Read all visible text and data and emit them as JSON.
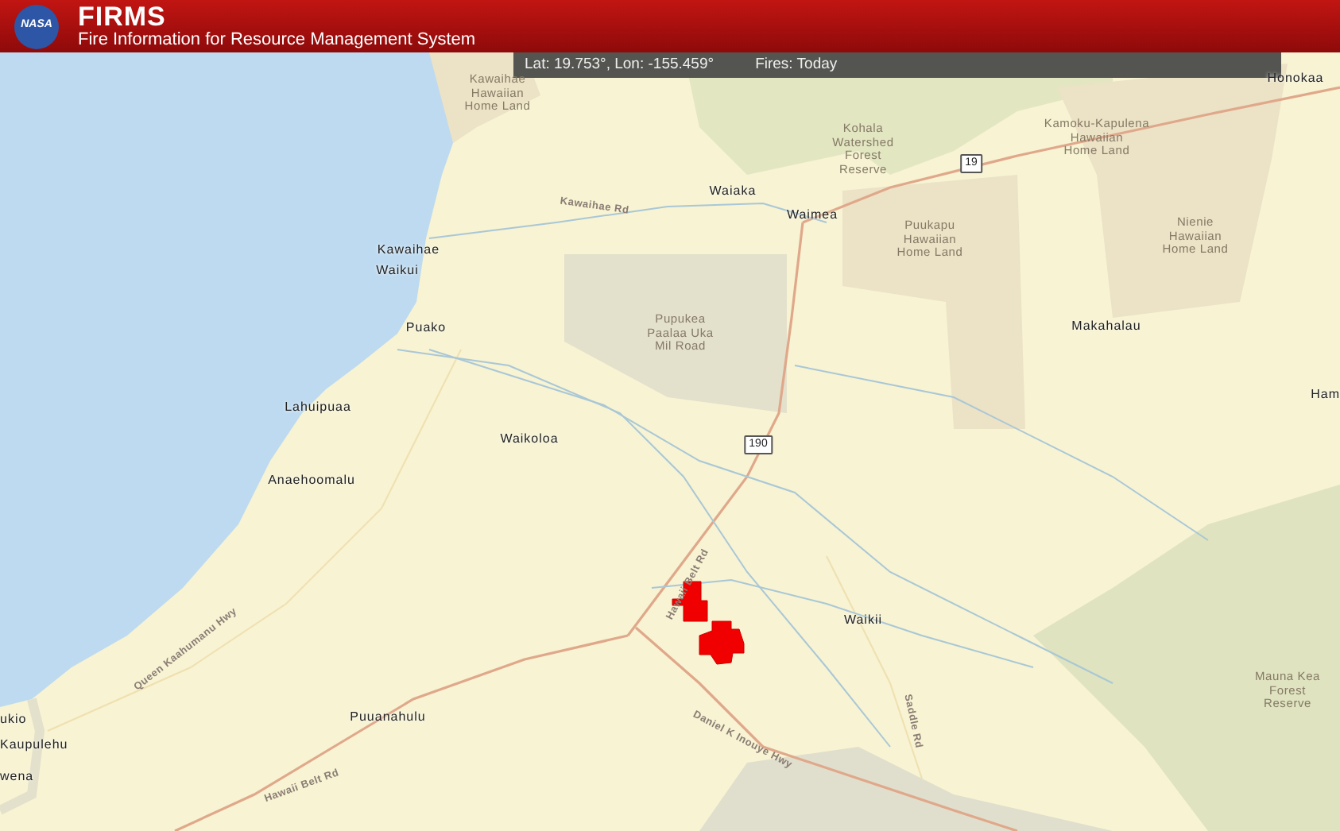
{
  "header": {
    "logo": "NASA",
    "title": "FIRMS",
    "subtitle": "Fire Information for Resource Management System"
  },
  "info_bar": {
    "coordinates": "Lat: 19.753°, Lon: -155.459°",
    "fires": "Fires: Today"
  },
  "map": {
    "place_labels": [
      "Honokaa",
      "Kawaihae",
      "Waikui",
      "Waiaka",
      "Waimea",
      "Puako",
      "Makahalau",
      "Ham",
      "Lahuipuaa",
      "Waikoloa",
      "Anaehoomalu",
      "Waikii",
      "ukio",
      "Kaupulehu",
      "Puuanahulu",
      "wena"
    ],
    "area_labels": [
      "Kawaihae\nHawaiian\nHome Land",
      "Kohala\nWatershed\nForest\nReserve",
      "Kamoku-Kapulena\nHawaiian\nHome Land",
      "Puukapu\nHawaiian\nHome Land",
      "Nienie\nHawaiian\nHome Land",
      "Pupukea\nPaalaa Uka\nMil Road",
      "Mauna Kea\nForest\nReserve"
    ],
    "road_labels": [
      "Kawaihae Rd",
      "Hawaii Belt Rd",
      "Queen Kaahumanu Hwy",
      "Daniel K Inouye Hwy",
      "Saddle Rd",
      "Hawaii Belt Rd"
    ],
    "route_shields": [
      "19",
      "190"
    ]
  }
}
